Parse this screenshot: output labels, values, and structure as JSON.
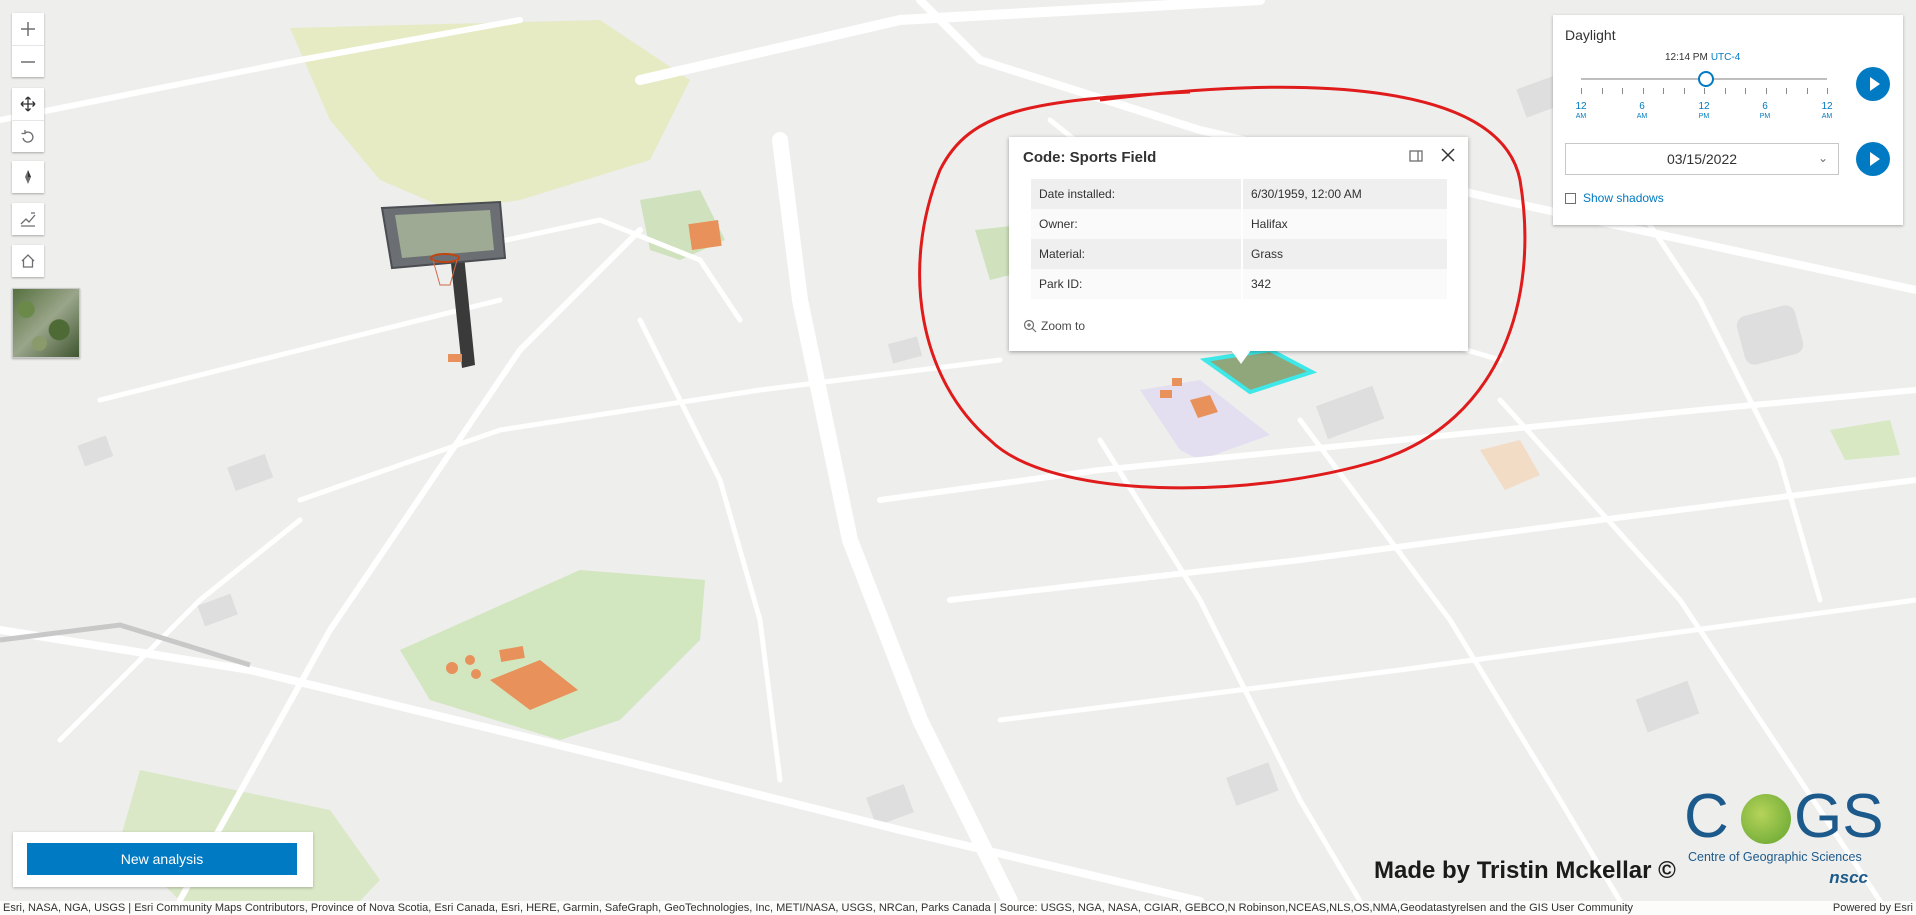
{
  "map": {
    "annotation_color": "#e01b1b",
    "selection_color": "#3ee8e8",
    "feature_colors": {
      "sports_field": "#e8915a",
      "park": "#c8e2b0",
      "meadow": "#e6ebc4",
      "building": "#dcdcdc",
      "road": "#ffffff"
    }
  },
  "navigation": {
    "zoom_in_icon": "plus-icon",
    "zoom_out_icon": "minus-icon",
    "pan_icon": "move-icon",
    "rotate_icon": "rotate-icon",
    "compass_icon": "compass-icon",
    "line_of_sight_icon": "line-of-sight-icon",
    "home_icon": "home-icon",
    "basemap_icon": "basemap-toggle"
  },
  "popup": {
    "title": "Code: Sports Field",
    "rows": [
      {
        "key": "Date installed:",
        "value": "6/30/1959, 12:00 AM"
      },
      {
        "key": "Owner:",
        "value": "Halifax"
      },
      {
        "key": "Material:",
        "value": "Grass"
      },
      {
        "key": "Park ID:",
        "value": "342"
      }
    ],
    "zoom_to": "Zoom to"
  },
  "daylight": {
    "title": "Daylight",
    "time": "12:14 PM",
    "utc": "UTC-4",
    "time_fraction": 0.51,
    "tick_labels": [
      {
        "hour": "12",
        "period": "AM"
      },
      {
        "hour": "6",
        "period": "AM"
      },
      {
        "hour": "12",
        "period": "PM"
      },
      {
        "hour": "6",
        "period": "PM"
      },
      {
        "hour": "12",
        "period": "AM"
      }
    ],
    "date": "03/15/2022",
    "show_shadows": "Show shadows",
    "accent": "#007ac2"
  },
  "analysis": {
    "button": "New analysis"
  },
  "credit": "Made by Tristin Mckellar ©",
  "logo": {
    "letters_left": "C",
    "letters_right": "GS",
    "subtitle": "Centre of Geographic Sciences",
    "nscc": "nscc"
  },
  "attribution": {
    "sources": "Esri, NASA, NGA, USGS | Esri Community Maps Contributors, Province of Nova Scotia, Esri Canada, Esri, HERE, Garmin, SafeGraph, GeoTechnologies, Inc, METI/NASA, USGS, NRCan, Parks Canada | Source: USGS, NGA, NASA, CGIAR, GEBCO,N Robinson,NCEAS,NLS,OS,NMA,Geodatastyrelsen and the GIS User Community",
    "powered": "Powered by Esri"
  }
}
